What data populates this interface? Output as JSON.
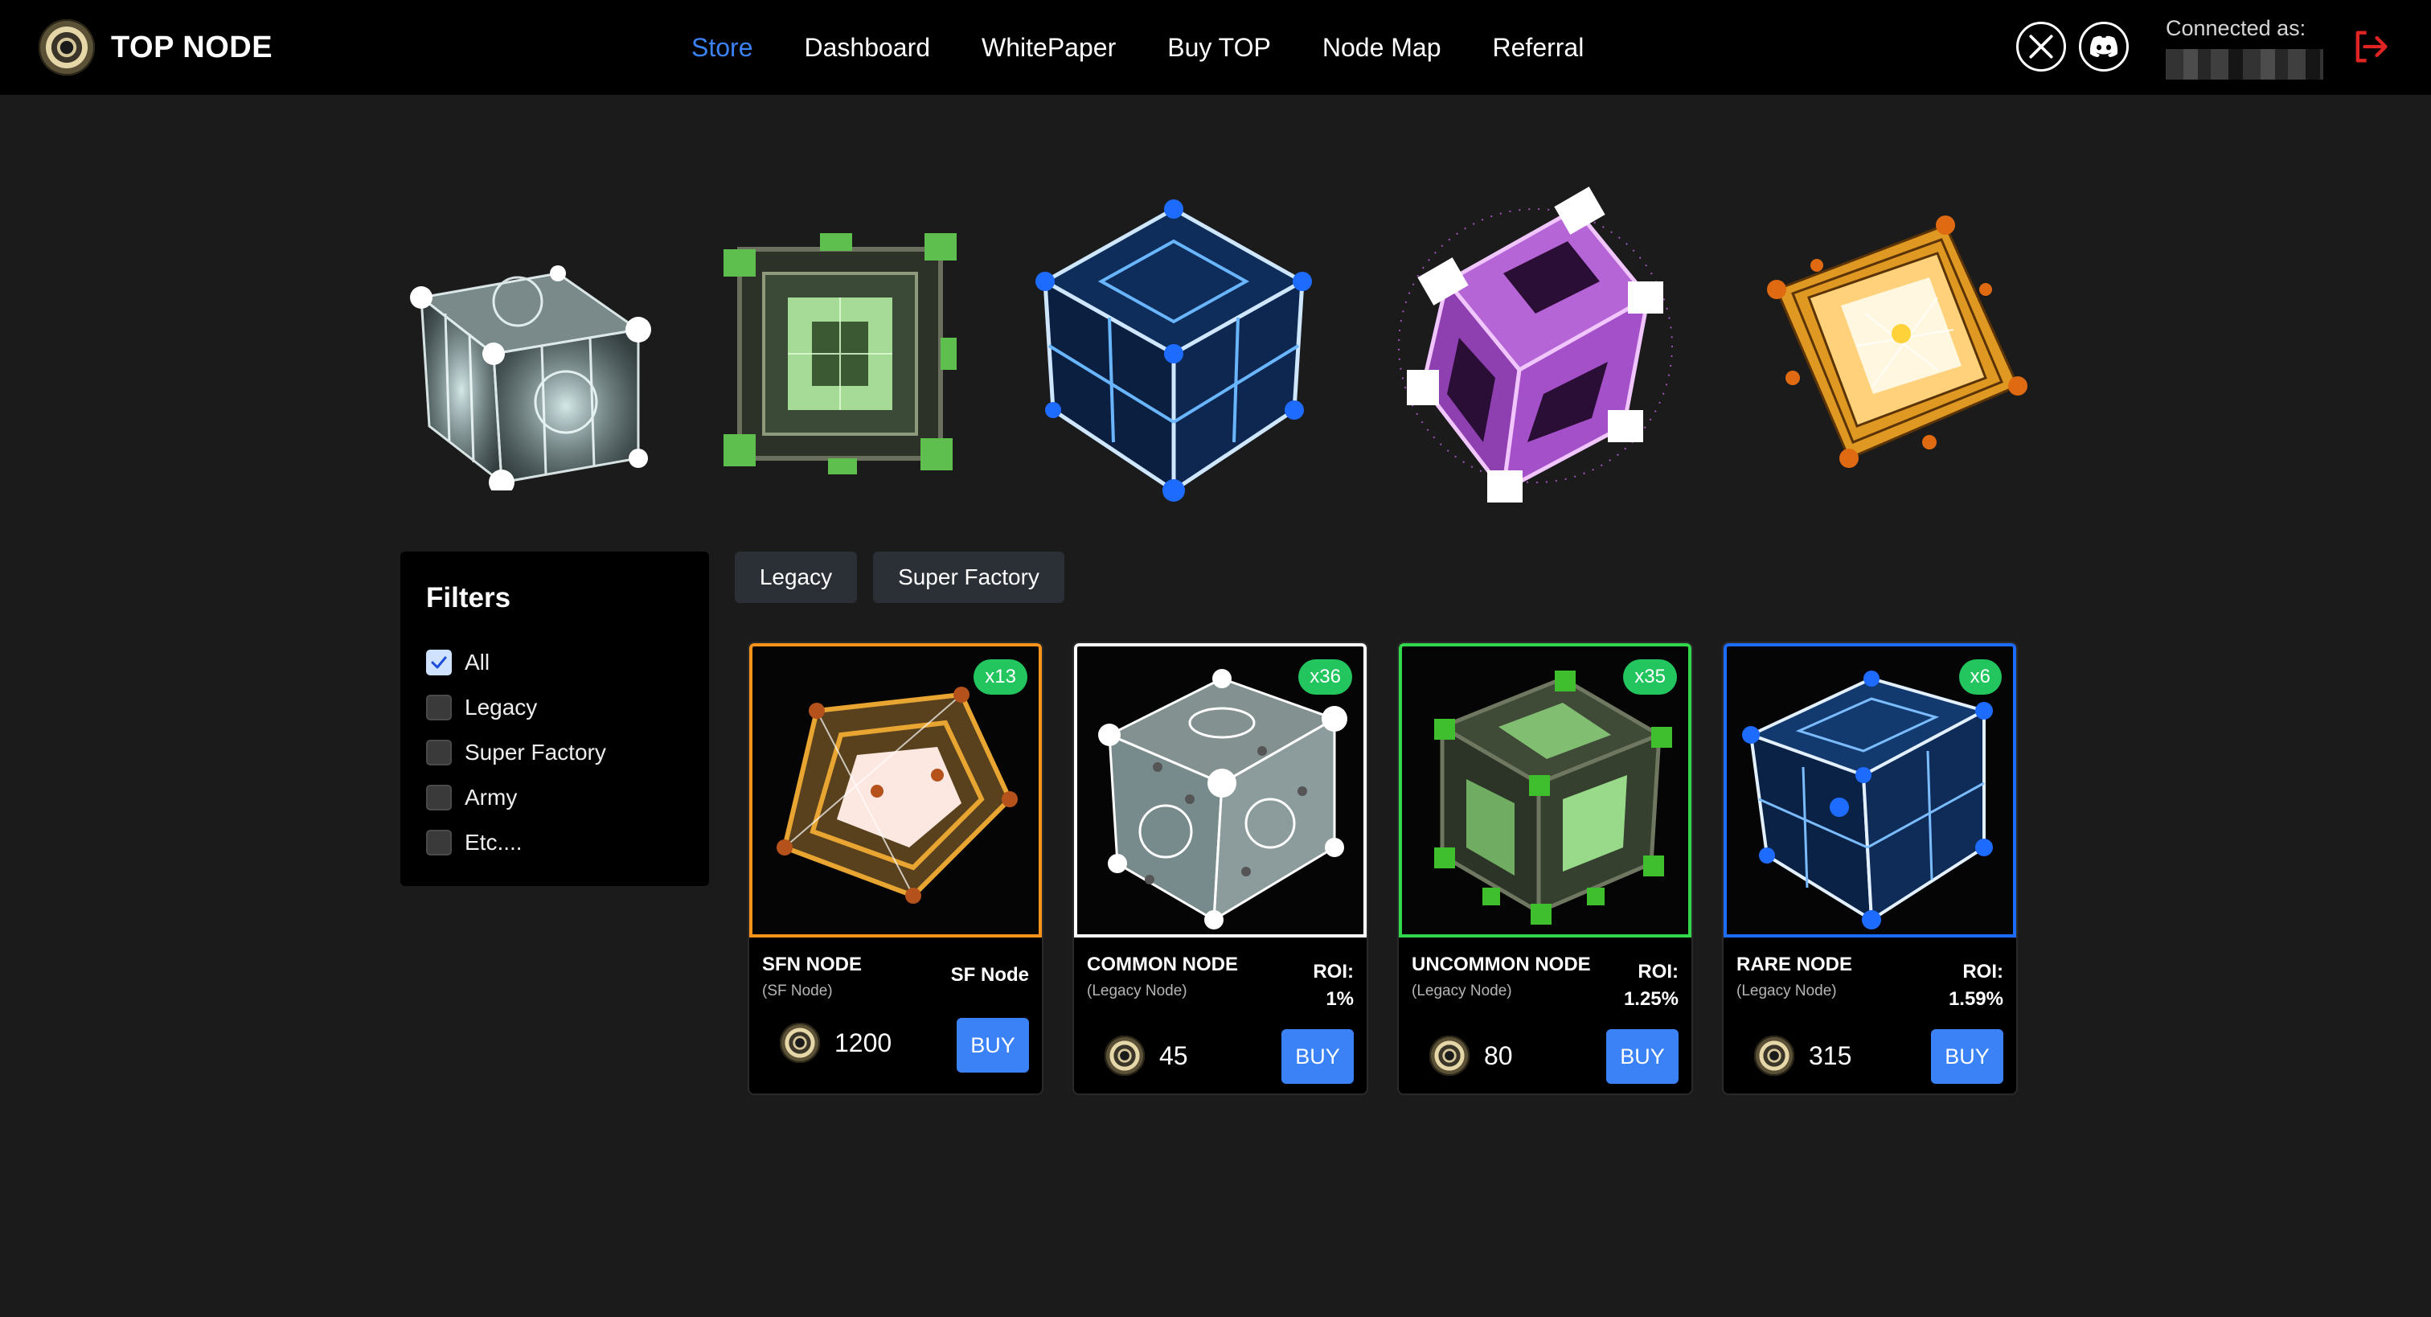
{
  "brand": {
    "name": "TOP NODE"
  },
  "nav": {
    "links": [
      "Store",
      "Dashboard",
      "WhitePaper",
      "Buy TOP",
      "Node Map",
      "Referral"
    ],
    "active": "Store"
  },
  "social": {
    "x": "x-icon",
    "discord": "discord-icon"
  },
  "account": {
    "connected_label": "Connected as:"
  },
  "colors": {
    "accent": "#3b82f6",
    "badge": "#22c55e",
    "logout": "#e02424"
  },
  "filters": {
    "title": "Filters",
    "options": [
      {
        "label": "All",
        "checked": true
      },
      {
        "label": "Legacy",
        "checked": false
      },
      {
        "label": "Super Factory",
        "checked": false
      },
      {
        "label": "Army",
        "checked": false
      },
      {
        "label": "Etc....",
        "checked": false
      }
    ]
  },
  "tabs": [
    "Legacy",
    "Super Factory"
  ],
  "cards": [
    {
      "name": "SFN NODE",
      "sub": "(SF Node)",
      "roi_label": "SF Node",
      "roi_value": "",
      "price": "1200",
      "qty": "x13",
      "buy": "BUY",
      "frame_color": "#f7931a"
    },
    {
      "name": "COMMON NODE",
      "sub": "(Legacy Node)",
      "roi_label": "ROI:",
      "roi_value": "1%",
      "price": "45",
      "qty": "x36",
      "buy": "BUY",
      "frame_color": "#ffffff"
    },
    {
      "name": "UNCOMMON NODE",
      "sub": "(Legacy Node)",
      "roi_label": "ROI:",
      "roi_value": "1.25%",
      "price": "80",
      "qty": "x35",
      "buy": "BUY",
      "frame_color": "#32d74b"
    },
    {
      "name": "RARE NODE",
      "sub": "(Legacy Node)",
      "roi_label": "ROI:",
      "roi_value": "1.59%",
      "price": "315",
      "qty": "x6",
      "buy": "BUY",
      "frame_color": "#1e6bff"
    }
  ]
}
